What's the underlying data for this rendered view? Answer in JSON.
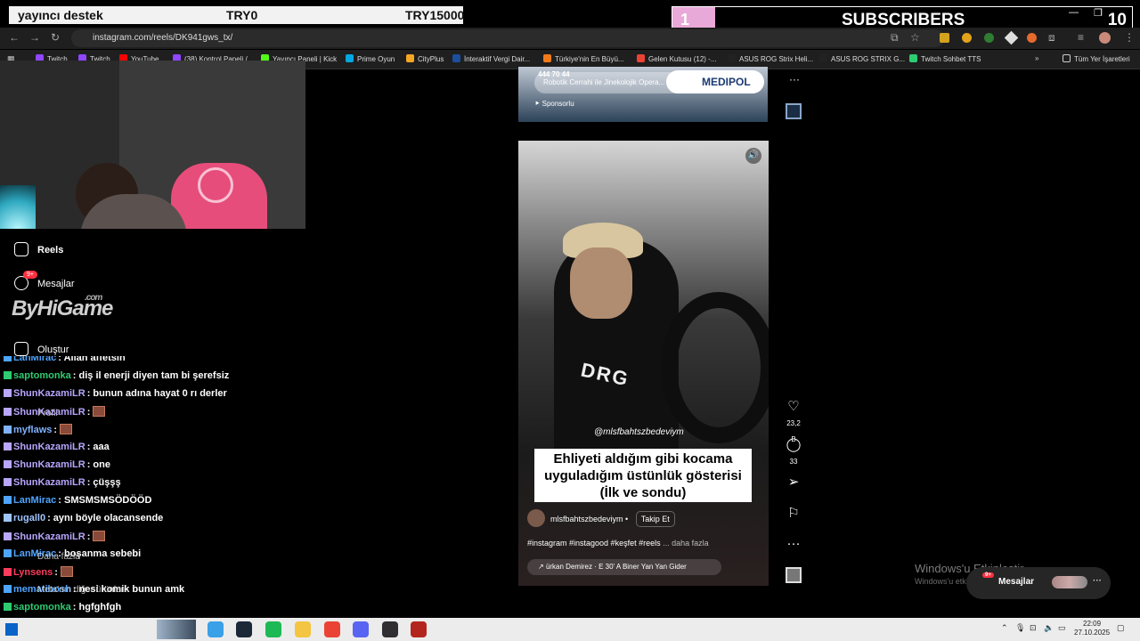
{
  "overlay": {
    "donation": {
      "label": "yayıncı destek",
      "currency": "TRY0",
      "goal": "TRY15000"
    },
    "subscribers": {
      "current": "1",
      "label": "SUBSCRIBERS",
      "goal": "10"
    }
  },
  "browser": {
    "url": "instagram.com/reels/DK941gws_tx/",
    "bookmarks": [
      {
        "label": "Twitch",
        "color": "#9146ff"
      },
      {
        "label": "Twitch",
        "color": "#9146ff"
      },
      {
        "label": "YouTube",
        "color": "#ff0000"
      },
      {
        "label": "(38) Kontrol Paneli /...",
        "color": "#9146ff"
      },
      {
        "label": "Yayıncı Paneli | Kick",
        "color": "#53fc18"
      },
      {
        "label": "Prime Oyun",
        "color": "#00a8e1"
      },
      {
        "label": "CityPlus",
        "color": "#f5a623"
      },
      {
        "label": "İnteraktif Vergi Dair...",
        "color": "#1c4e9e"
      },
      {
        "label": "Türkiye'nin En Büyü...",
        "color": "#f27a1a"
      },
      {
        "label": "Gelen Kutusu (12) -...",
        "color": "#ea4335"
      },
      {
        "label": "ASUS ROG Strix Heli...",
        "color": "#222222"
      },
      {
        "label": "ASUS ROG STRIX G...",
        "color": "#222222"
      },
      {
        "label": "Twitch Sohbet TTS",
        "color": "#2ecc71"
      }
    ],
    "all_bookmarks": "Tüm Yer İşaretleri"
  },
  "instagram_nav": {
    "reels": "Reels",
    "messages": "Mesajlar",
    "messages_badge": "9+",
    "create": "Oluştur",
    "profile": "Profil",
    "more": "Daha fazla",
    "meta": "Meta'nın diğer ürünleri"
  },
  "brand": {
    "name": "ByHiGame",
    "suffix": ".com"
  },
  "chat": [
    {
      "user": "LanMirac",
      "color": "#4ea4ff",
      "msg": ": Allah affetsin",
      "emote": false
    },
    {
      "user": "saptomonka",
      "color": "#2ecc71",
      "msg": ": diş il enerji diyen tam bi şerefsiz",
      "emote": false
    },
    {
      "user": "ShunKazamiLR",
      "color": "#b8a6ff",
      "msg": ": bunun adına hayat 0 rı derler",
      "emote": false
    },
    {
      "user": "ShunKazamiLR",
      "color": "#b8a6ff",
      "msg": ":",
      "emote": true
    },
    {
      "user": "myflaws",
      "color": "#7fb3ff",
      "msg": ":",
      "emote": true
    },
    {
      "user": "ShunKazamiLR",
      "color": "#b8a6ff",
      "msg": ": aaa",
      "emote": false
    },
    {
      "user": "ShunKazamiLR",
      "color": "#b8a6ff",
      "msg": ": one",
      "emote": false
    },
    {
      "user": "ShunKazamiLR",
      "color": "#b8a6ff",
      "msg": ": çüşşş",
      "emote": false
    },
    {
      "user": "LanMirac",
      "color": "#4ea4ff",
      "msg": ": SMSMSMSÖDÖÖD",
      "emote": false
    },
    {
      "user": "rugall0",
      "color": "#9fc4ff",
      "msg": ": aynı böyle olacansende",
      "emote": false
    },
    {
      "user": "ShunKazamiLR",
      "color": "#b8a6ff",
      "msg": ":",
      "emote": true
    },
    {
      "user": "LanMirac",
      "color": "#4ea4ff",
      "msg": ": boşanma sebebi",
      "emote": false
    },
    {
      "user": "Lynsens",
      "color": "#ff3b5c",
      "msg": ":",
      "emote": true
    },
    {
      "user": "mematibosh",
      "color": "#4ea4ff",
      "msg": ": nesi komik bunun amk",
      "emote": false
    },
    {
      "user": "saptomonka",
      "color": "#2ecc71",
      "msg": ": hgfghfgh",
      "emote": false
    },
    {
      "user": "ShunKazamiLR",
      "color": "#b8a6ff",
      "msg": ":",
      "emote": true
    }
  ],
  "reel_prev": {
    "title": "Robotik Cerrahi ile Jinekolojik Opera... Daha",
    "sponsor_brand": "MEDIPOL",
    "sponsor_label": "Sponsorlu",
    "phone": "444 70 44"
  },
  "reel": {
    "watermark": "@mlsfbahtszbedeviym",
    "caption_line1": "Ehliyeti aldığım gibi kocama",
    "caption_line2": "uyguladığım üstünlük gösterisi",
    "caption_line3": "(İlk ve sondu)",
    "author": "mlsfbahtszbedeviym",
    "follow": "Takip Et",
    "tags": "#instagram #instagood #keşfet #reels",
    "more": "... daha fazla",
    "audio": "ürkan Demirez · E 30' A Biner Yan Yan Gider",
    "likes": "23,2 B",
    "comments": "33"
  },
  "windows": {
    "activate_title": "Windows'u Etkinleştir",
    "activate_sub": "Windows'u etkinleştirmek için Ayarlar'a gidin."
  },
  "messages_pill": {
    "label": "Mesajlar",
    "badge": "9+"
  },
  "taskbar": {
    "time": "22:09",
    "date": "27.10.2025",
    "icons": [
      {
        "name": "edge-icon",
        "color": "#3aa0e8"
      },
      {
        "name": "steam-icon",
        "color": "#1b2838"
      },
      {
        "name": "spotify-icon",
        "color": "#1db954"
      },
      {
        "name": "explorer-icon",
        "color": "#f4c542"
      },
      {
        "name": "chrome-icon",
        "color": "#ea4335"
      },
      {
        "name": "discord-icon",
        "color": "#5865f2"
      },
      {
        "name": "obs-icon",
        "color": "#302e31"
      },
      {
        "name": "app-icon",
        "color": "#b3261e"
      }
    ]
  }
}
